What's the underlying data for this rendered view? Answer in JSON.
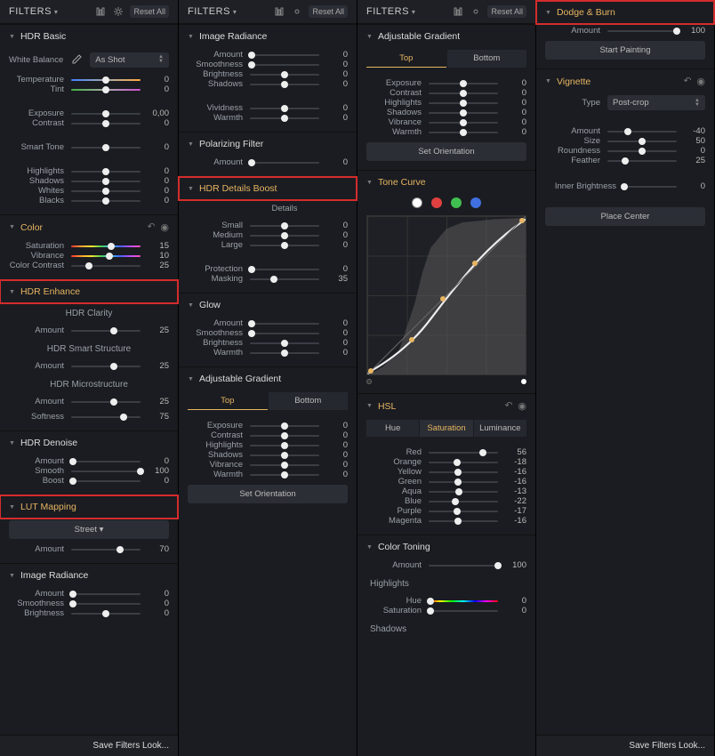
{
  "header": {
    "title": "FILTERS",
    "reset": "Reset All"
  },
  "save_look": "Save Filters Look...",
  "panel1": {
    "hdr_basic": {
      "title": "HDR Basic",
      "wb_label": "White Balance",
      "wb_value": "As Shot",
      "rows": [
        {
          "label": "Temperature",
          "val": "0",
          "track": "temp",
          "pos": 50
        },
        {
          "label": "Tint",
          "val": "0",
          "track": "tint",
          "pos": 50
        }
      ],
      "rows2": [
        {
          "label": "Exposure",
          "val": "0,00",
          "pos": 50
        },
        {
          "label": "Contrast",
          "val": "0",
          "pos": 50
        }
      ],
      "smart_tone_label": "Smart Tone",
      "smart_tone": {
        "val": "0",
        "pos": 50
      },
      "rows3": [
        {
          "label": "Highlights",
          "val": "0",
          "pos": 50
        },
        {
          "label": "Shadows",
          "val": "0",
          "pos": 50
        },
        {
          "label": "Whites",
          "val": "0",
          "pos": 50
        },
        {
          "label": "Blacks",
          "val": "0",
          "pos": 50
        }
      ]
    },
    "color": {
      "title": "Color",
      "rows": [
        {
          "label": "Saturation",
          "val": "15",
          "track": "rainbow",
          "pos": 58
        },
        {
          "label": "Vibrance",
          "val": "10",
          "track": "rainbow",
          "pos": 55
        },
        {
          "label": "Color Contrast",
          "val": "25",
          "pos": 25
        }
      ]
    },
    "hdr_enhance": {
      "title": "HDR Enhance",
      "groups": [
        {
          "name": "HDR Clarity",
          "rows": [
            {
              "label": "Amount",
              "val": "25",
              "pos": 62
            }
          ]
        },
        {
          "name": "HDR Smart Structure",
          "rows": [
            {
              "label": "Amount",
              "val": "25",
              "pos": 62
            }
          ]
        },
        {
          "name": "HDR Microstructure",
          "rows": [
            {
              "label": "Amount",
              "val": "25",
              "pos": 62
            },
            {
              "label": "Softness",
              "val": "75",
              "pos": 75
            }
          ]
        }
      ]
    },
    "hdr_denoise": {
      "title": "HDR Denoise",
      "rows": [
        {
          "label": "Amount",
          "val": "0",
          "pos": 2
        },
        {
          "label": "Smooth",
          "val": "100",
          "pos": 100
        },
        {
          "label": "Boost",
          "val": "0",
          "pos": 2
        }
      ]
    },
    "lut": {
      "title": "LUT Mapping",
      "preset": "Street",
      "rows": [
        {
          "label": "Amount",
          "val": "70",
          "pos": 70
        }
      ]
    },
    "radiance": {
      "title": "Image Radiance",
      "rows": [
        {
          "label": "Amount",
          "val": "0",
          "pos": 2
        },
        {
          "label": "Smoothness",
          "val": "0",
          "pos": 2
        },
        {
          "label": "Brightness",
          "val": "0",
          "pos": 50
        }
      ]
    }
  },
  "panel2": {
    "radiance": {
      "title": "Image Radiance",
      "rows": [
        {
          "label": "Amount",
          "val": "0",
          "pos": 2
        },
        {
          "label": "Smoothness",
          "val": "0",
          "pos": 2
        },
        {
          "label": "Brightness",
          "val": "0",
          "pos": 50
        },
        {
          "label": "Shadows",
          "val": "0",
          "pos": 50
        }
      ],
      "rows2": [
        {
          "label": "Vividness",
          "val": "0",
          "pos": 50
        },
        {
          "label": "Warmth",
          "val": "0",
          "pos": 50
        }
      ]
    },
    "polar": {
      "title": "Polarizing Filter",
      "rows": [
        {
          "label": "Amount",
          "val": "0",
          "pos": 2
        }
      ]
    },
    "boost": {
      "title": "HDR Details Boost",
      "details_label": "Details",
      "rows": [
        {
          "label": "Small",
          "val": "0",
          "pos": 50
        },
        {
          "label": "Medium",
          "val": "0",
          "pos": 50
        },
        {
          "label": "Large",
          "val": "0",
          "pos": 50
        }
      ],
      "rows2": [
        {
          "label": "Protection",
          "val": "0",
          "pos": 2
        },
        {
          "label": "Masking",
          "val": "35",
          "pos": 35
        }
      ]
    },
    "glow": {
      "title": "Glow",
      "rows": [
        {
          "label": "Amount",
          "val": "0",
          "pos": 2
        },
        {
          "label": "Smoothness",
          "val": "0",
          "pos": 2
        },
        {
          "label": "Brightness",
          "val": "0",
          "pos": 50
        },
        {
          "label": "Warmth",
          "val": "0",
          "pos": 50
        }
      ]
    },
    "gradient": {
      "title": "Adjustable Gradient",
      "tabs": [
        "Top",
        "Bottom"
      ],
      "active_tab": "Top",
      "rows": [
        {
          "label": "Exposure",
          "val": "0",
          "pos": 50
        },
        {
          "label": "Contrast",
          "val": "0",
          "pos": 50
        },
        {
          "label": "Highlights",
          "val": "0",
          "pos": 50
        },
        {
          "label": "Shadows",
          "val": "0",
          "pos": 50
        },
        {
          "label": "Vibrance",
          "val": "0",
          "pos": 50
        },
        {
          "label": "Warmth",
          "val": "0",
          "pos": 50
        }
      ],
      "btn": "Set Orientation"
    }
  },
  "panel3": {
    "gradient": {
      "title": "Adjustable Gradient",
      "tabs": [
        "Top",
        "Bottom"
      ],
      "active_tab": "Top",
      "rows": [
        {
          "label": "Exposure",
          "val": "0",
          "pos": 50
        },
        {
          "label": "Contrast",
          "val": "0",
          "pos": 50
        },
        {
          "label": "Highlights",
          "val": "0",
          "pos": 50
        },
        {
          "label": "Shadows",
          "val": "0",
          "pos": 50
        },
        {
          "label": "Vibrance",
          "val": "0",
          "pos": 50
        },
        {
          "label": "Warmth",
          "val": "0",
          "pos": 50
        }
      ],
      "btn": "Set Orientation"
    },
    "tone_curve": {
      "title": "Tone Curve",
      "colors": [
        "#ffffff",
        "#e04040",
        "#40c050",
        "#4070e0"
      ]
    },
    "hsl": {
      "title": "HSL",
      "tabs": [
        "Hue",
        "Saturation",
        "Luminance"
      ],
      "active_tab": "Saturation",
      "rows": [
        {
          "label": "Red",
          "val": "56",
          "pos": 78
        },
        {
          "label": "Orange",
          "val": "-18",
          "pos": 41
        },
        {
          "label": "Yellow",
          "val": "-16",
          "pos": 42
        },
        {
          "label": "Green",
          "val": "-16",
          "pos": 42
        },
        {
          "label": "Aqua",
          "val": "-13",
          "pos": 43
        },
        {
          "label": "Blue",
          "val": "-22",
          "pos": 39
        },
        {
          "label": "Purple",
          "val": "-17",
          "pos": 41
        },
        {
          "label": "Magenta",
          "val": "-16",
          "pos": 42
        }
      ]
    },
    "color_toning": {
      "title": "Color Toning",
      "amount": {
        "label": "Amount",
        "val": "100",
        "pos": 100
      },
      "highlights_label": "Highlights",
      "rows": [
        {
          "label": "Hue",
          "val": "0",
          "track": "hue",
          "pos": 2
        },
        {
          "label": "Saturation",
          "val": "0",
          "pos": 2
        }
      ],
      "shadows_label": "Shadows"
    }
  },
  "panel4": {
    "dodge": {
      "title": "Dodge & Burn",
      "amount": {
        "label": "Amount",
        "val": "100",
        "pos": 100
      },
      "btn": "Start Painting"
    },
    "vignette": {
      "title": "Vignette",
      "type_label": "Type",
      "type_value": "Post-crop",
      "rows": [
        {
          "label": "Amount",
          "val": "-40",
          "pos": 30
        },
        {
          "label": "Size",
          "val": "50",
          "pos": 50
        },
        {
          "label": "Roundness",
          "val": "0",
          "pos": 50
        },
        {
          "label": "Feather",
          "val": "25",
          "pos": 25
        }
      ],
      "inner": {
        "label": "Inner Brightness",
        "val": "0",
        "pos": 2
      },
      "btn": "Place Center"
    }
  }
}
